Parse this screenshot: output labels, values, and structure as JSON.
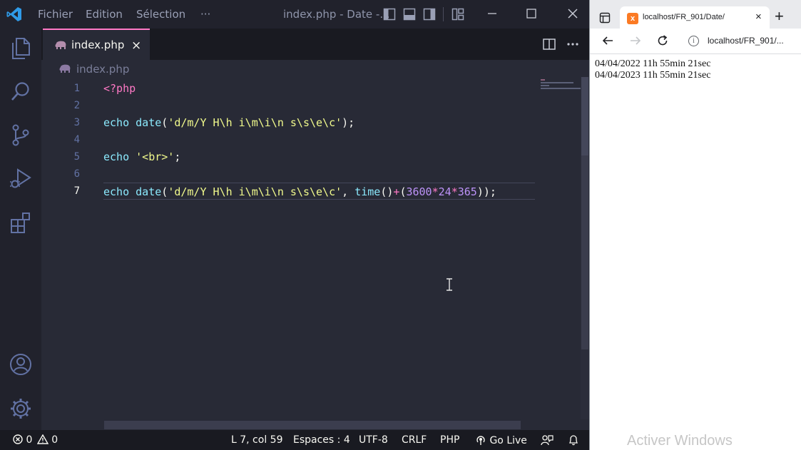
{
  "vscode": {
    "menu": [
      "Fichier",
      "Edition",
      "Sélection"
    ],
    "more_menu": "···",
    "window_title": "index.php - Date -...",
    "tab": {
      "label": "index.php",
      "close": "×"
    },
    "breadcrumb": "index.php",
    "line_numbers": [
      "1",
      "2",
      "3",
      "4",
      "5",
      "6",
      "7"
    ],
    "active_line": 7,
    "code_lines": [
      [
        {
          "t": "<?php",
          "c": "pink"
        }
      ],
      [],
      [
        {
          "t": "echo",
          "c": "cyan"
        },
        {
          "t": " ",
          "c": "white"
        },
        {
          "t": "date",
          "c": "cyan"
        },
        {
          "t": "(",
          "c": "white"
        },
        {
          "t": "'d/m/Y H\\h i\\m\\i\\n s\\s\\e\\c'",
          "c": "yellow"
        },
        {
          "t": ");",
          "c": "white"
        }
      ],
      [],
      [
        {
          "t": "echo",
          "c": "cyan"
        },
        {
          "t": " ",
          "c": "white"
        },
        {
          "t": "'<br>'",
          "c": "yellow"
        },
        {
          "t": ";",
          "c": "white"
        }
      ],
      [],
      [
        {
          "t": "echo",
          "c": "cyan"
        },
        {
          "t": " ",
          "c": "white"
        },
        {
          "t": "date",
          "c": "cyan"
        },
        {
          "t": "(",
          "c": "white"
        },
        {
          "t": "'d/m/Y H\\h i\\m\\i\\n s\\s\\e\\c'",
          "c": "yellow"
        },
        {
          "t": ", ",
          "c": "white"
        },
        {
          "t": "time",
          "c": "cyan"
        },
        {
          "t": "()",
          "c": "white"
        },
        {
          "t": "+",
          "c": "pink"
        },
        {
          "t": "(",
          "c": "white"
        },
        {
          "t": "3600",
          "c": "purple"
        },
        {
          "t": "*",
          "c": "pink"
        },
        {
          "t": "24",
          "c": "purple"
        },
        {
          "t": "*",
          "c": "pink"
        },
        {
          "t": "365",
          "c": "purple"
        },
        {
          "t": "));",
          "c": "white"
        }
      ]
    ],
    "status": {
      "errors": "0",
      "warnings": "0",
      "position": "L 7, col 59",
      "indent": "Espaces : 4",
      "encoding": "UTF-8",
      "eol": "CRLF",
      "language": "PHP",
      "golive": "Go Live"
    },
    "colors": {
      "accent": "#ff79c6",
      "editor_bg": "#282a36",
      "sidebar_bg": "#21222c"
    }
  },
  "browser": {
    "tab_title": "localhost/FR_901/Date/",
    "tab_close": "×",
    "new_tab": "+",
    "url": "localhost/FR_901/...",
    "output_lines": [
      "04/04/2022 11h 55min 21sec",
      "04/04/2023 11h 55min 21sec"
    ]
  },
  "watermark": "Activer Windows"
}
